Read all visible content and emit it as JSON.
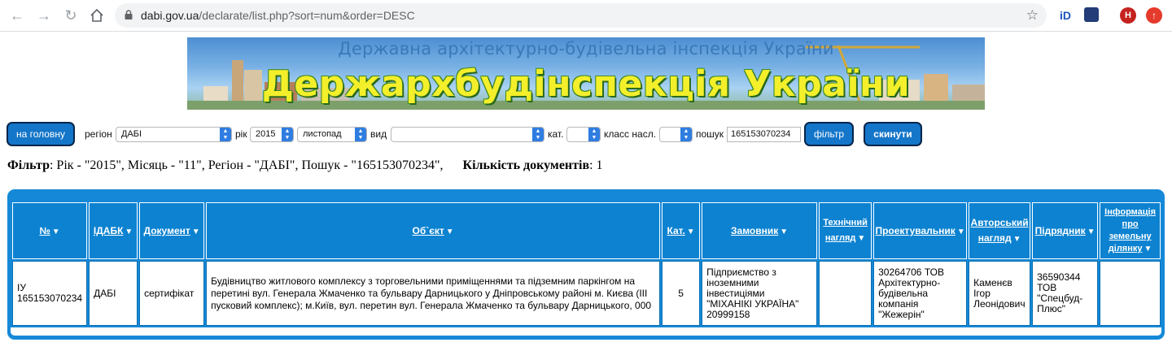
{
  "browser": {
    "url_host": "dabi.gov.ua",
    "url_path": "/declarate/list.php?sort=num&order=DESC",
    "ext1": "iD",
    "ext2": "H"
  },
  "banner": {
    "subtitle": "Державна архітектурно-будівельна інспекція України",
    "title": "Держархбудінспекція України"
  },
  "filters": {
    "home_button": "на головну",
    "region_label": "регіон",
    "region_value": "ДАБІ",
    "year_label": "рік",
    "year_value": "2015",
    "month_value": "листопад",
    "type_label": "вид",
    "type_value": "",
    "cat_label": "кат.",
    "cat_value": "",
    "class_label": "класс насл.",
    "class_value": "",
    "search_label": "пошук",
    "search_value": "165153070234",
    "filter_button": "фільтр",
    "reset_button": "скинути"
  },
  "summary": {
    "filter_label": "Фільтр",
    "filter_text": ": Рік - \"2015\", Місяць - \"11\", Регіон - \"ДАБІ\", Пошук - \"165153070234\",",
    "count_label": "Кількість документів",
    "count_text": ": 1"
  },
  "table": {
    "headers": [
      "№",
      "ІДАБК",
      "Документ",
      "Об`єкт",
      "Кат.",
      "Замовник",
      "Технічний нагляд",
      "Проектувальник",
      "Авторський нагляд",
      "Підрядник",
      "Інформація про земельну ділянку"
    ],
    "rows": [
      {
        "num": "ІУ 165153070234",
        "idabk": "ДАБІ",
        "doc": "сертифікат",
        "object": "Будівництво житлового комплексу з торговельними приміщеннями та підземним паркінгом на перетині вул. Генерала Жмаченко та бульвару Дарницького у Дніпровському районі м. Києва (ІІІ пусковий комплекс); м.Київ, вул. перетин вул. Генерала Жмаченко та бульвару Дарницького, 000",
        "cat": "5",
        "customer": "Підприємство з іноземними інвестиціями \"МІХАНІКІ УКРАЇНА\" 20999158",
        "tech": "",
        "designer": "30264706 ТОВ Архітектурно-будівельна компанія \"Жежерін\"",
        "author": "Каменєв Ігор Леонідович",
        "contractor": "36590344 ТОВ \"Спецбуд-Плюс\"",
        "land": ""
      }
    ]
  }
}
